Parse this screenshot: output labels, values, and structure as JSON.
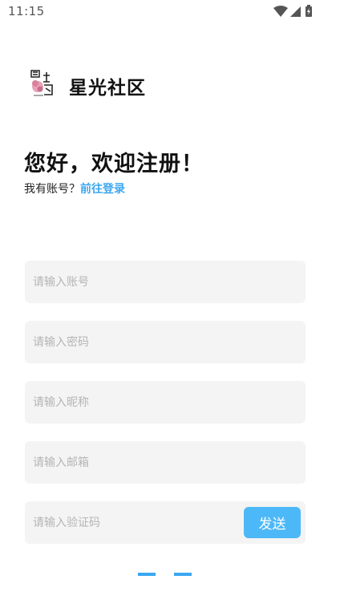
{
  "status_bar": {
    "time": "11:15",
    "icons": [
      "wifi-icon",
      "cellular-signal-icon",
      "battery-icon"
    ]
  },
  "brand": {
    "name": "星光社区",
    "logo_icon": "brand-logo-icon"
  },
  "greeting": {
    "title": "您好，欢迎注册！",
    "have_account_text": "我有账号？",
    "login_link": "前往登录"
  },
  "form": {
    "account_placeholder": "请输入账号",
    "password_placeholder": "请输入密码",
    "nickname_placeholder": "请输入昵称",
    "email_placeholder": "请输入邮箱",
    "code_placeholder": "请输入验证码",
    "send_button": "发送"
  },
  "colors": {
    "accent": "#3aa7f0",
    "send_button_bg": "#4db8f7",
    "field_bg": "#f4f4f4"
  }
}
